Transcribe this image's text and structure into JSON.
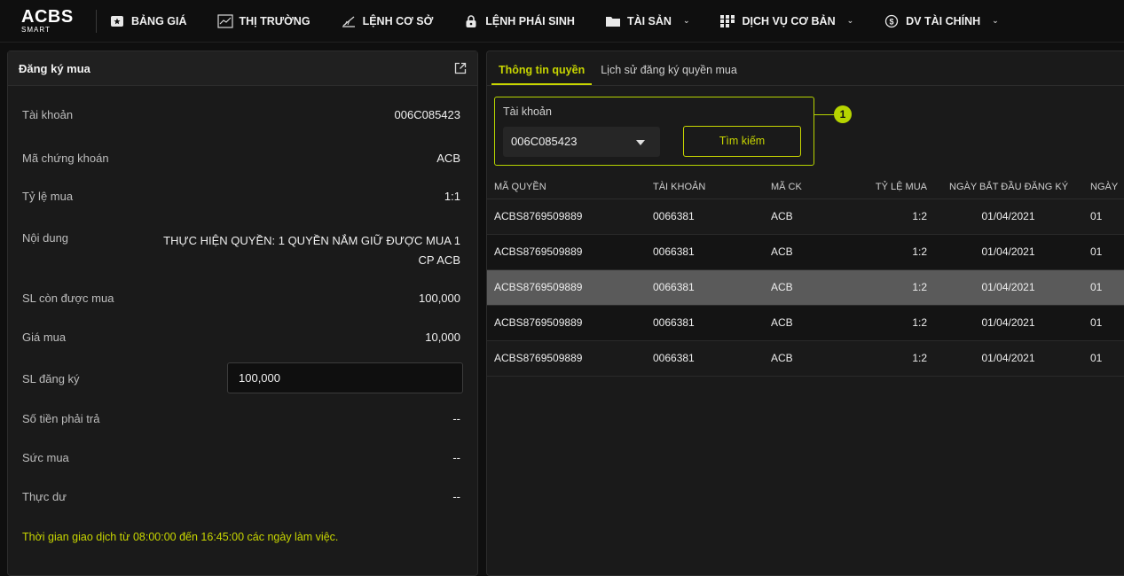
{
  "logo": {
    "top": "ACBS",
    "bottom": "SMART"
  },
  "nav": [
    {
      "label": "BẢNG GIÁ",
      "icon": "star-square-icon",
      "chevron": false
    },
    {
      "label": "THỊ TRƯỜNG",
      "icon": "chart-line-icon",
      "chevron": false
    },
    {
      "label": "LỆNH CƠ SỞ",
      "icon": "pen-order-icon",
      "chevron": false
    },
    {
      "label": "LỆNH PHÁI SINH",
      "icon": "lock-icon",
      "chevron": false
    },
    {
      "label": "TÀI SẢN",
      "icon": "folder-icon",
      "chevron": true
    },
    {
      "label": "DỊCH VỤ CƠ BẢN",
      "icon": "grid-icon",
      "chevron": true
    },
    {
      "label": "DV TÀI CHÍNH",
      "icon": "dollar-circle-icon",
      "chevron": true
    }
  ],
  "left_panel": {
    "title": "Đăng ký mua",
    "fields": {
      "account": {
        "label": "Tài khoản",
        "value": "006C085423"
      },
      "symbol": {
        "label": "Mã chứng khoán",
        "value": "ACB"
      },
      "ratio": {
        "label": "Tỷ lệ mua",
        "value": "1:1"
      },
      "content": {
        "label": "Nội dung",
        "value": "THỰC HIỆN QUYỀN: 1 QUYỀN NẮM GIỮ ĐƯỢC MUA 1 CP ACB"
      },
      "remaining": {
        "label": "SL còn được mua",
        "value": "100,000"
      },
      "price": {
        "label": "Giá mua",
        "value": "10,000"
      },
      "register_qty": {
        "label": "SL đăng ký",
        "value": "100,000"
      },
      "amount_due": {
        "label": "Số tiền phải trả",
        "value": "--"
      },
      "buying_power": {
        "label": "Sức mua",
        "value": "--"
      },
      "remainder": {
        "label": "Thực dư",
        "value": "--"
      }
    },
    "note": "Thời gian giao dịch từ 08:00:00 đến 16:45:00 các ngày làm việc."
  },
  "right_panel": {
    "tabs": [
      {
        "label": "Thông tin quyền",
        "active": true
      },
      {
        "label": "Lịch sử đăng ký quyền mua",
        "active": false
      }
    ],
    "search": {
      "label": "Tài khoản",
      "selected_account": "006C085423",
      "button_label": "Tìm kiếm",
      "callout_number": "1"
    },
    "table": {
      "headers": [
        "MÃ QUYỀN",
        "TÀI KHOẢN",
        "MÃ CK",
        "TỶ LỆ MUA",
        "NGÀY BẮT ĐẦU ĐĂNG KÝ",
        "NGÀY"
      ],
      "rows": [
        [
          "ACBS8769509889",
          "0066381",
          "ACB",
          "1:2",
          "01/04/2021",
          "01"
        ],
        [
          "ACBS8769509889",
          "0066381",
          "ACB",
          "1:2",
          "01/04/2021",
          "01"
        ],
        [
          "ACBS8769509889",
          "0066381",
          "ACB",
          "1:2",
          "01/04/2021",
          "01"
        ],
        [
          "ACBS8769509889",
          "0066381",
          "ACB",
          "1:2",
          "01/04/2021",
          "01"
        ],
        [
          "ACBS8769509889",
          "0066381",
          "ACB",
          "1:2",
          "01/04/2021",
          "01"
        ]
      ],
      "selected_row": 2
    }
  },
  "colors": {
    "accent": "#c8d600",
    "background": "#0f0f0f",
    "panel": "#1a1a1a",
    "selected_row": "#5a5a5a"
  }
}
